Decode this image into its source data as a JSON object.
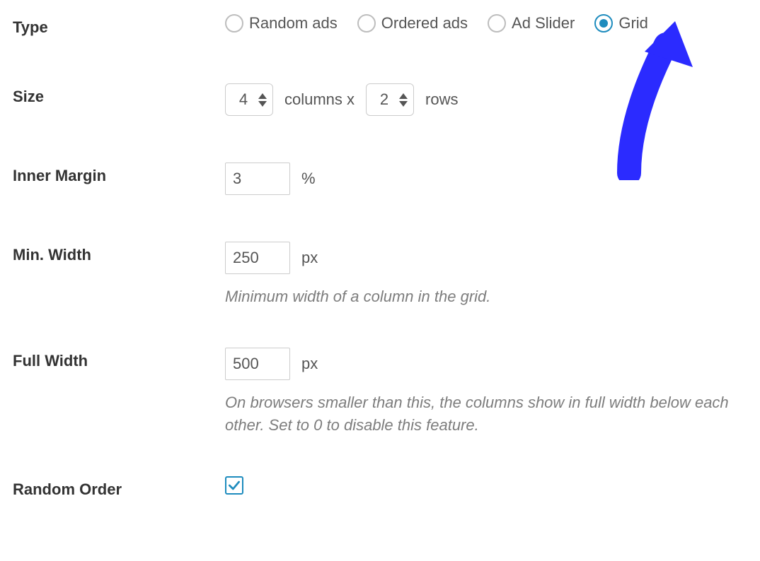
{
  "type": {
    "label": "Type",
    "options": [
      {
        "label": "Random ads",
        "selected": false
      },
      {
        "label": "Ordered ads",
        "selected": false
      },
      {
        "label": "Ad Slider",
        "selected": false
      },
      {
        "label": "Grid",
        "selected": true
      }
    ]
  },
  "size": {
    "label": "Size",
    "columns": "4",
    "mid": "columns x",
    "rows": "2",
    "tail": "rows"
  },
  "inner_margin": {
    "label": "Inner Margin",
    "value": "3",
    "unit": "%"
  },
  "min_width": {
    "label": "Min. Width",
    "value": "250",
    "unit": "px",
    "desc": "Minimum width of a column in the grid."
  },
  "full_width": {
    "label": "Full Width",
    "value": "500",
    "unit": "px",
    "desc": "On browsers smaller than this, the columns show in full width below each other. Set to 0 to disable this feature."
  },
  "random_order": {
    "label": "Random Order",
    "checked": true
  }
}
